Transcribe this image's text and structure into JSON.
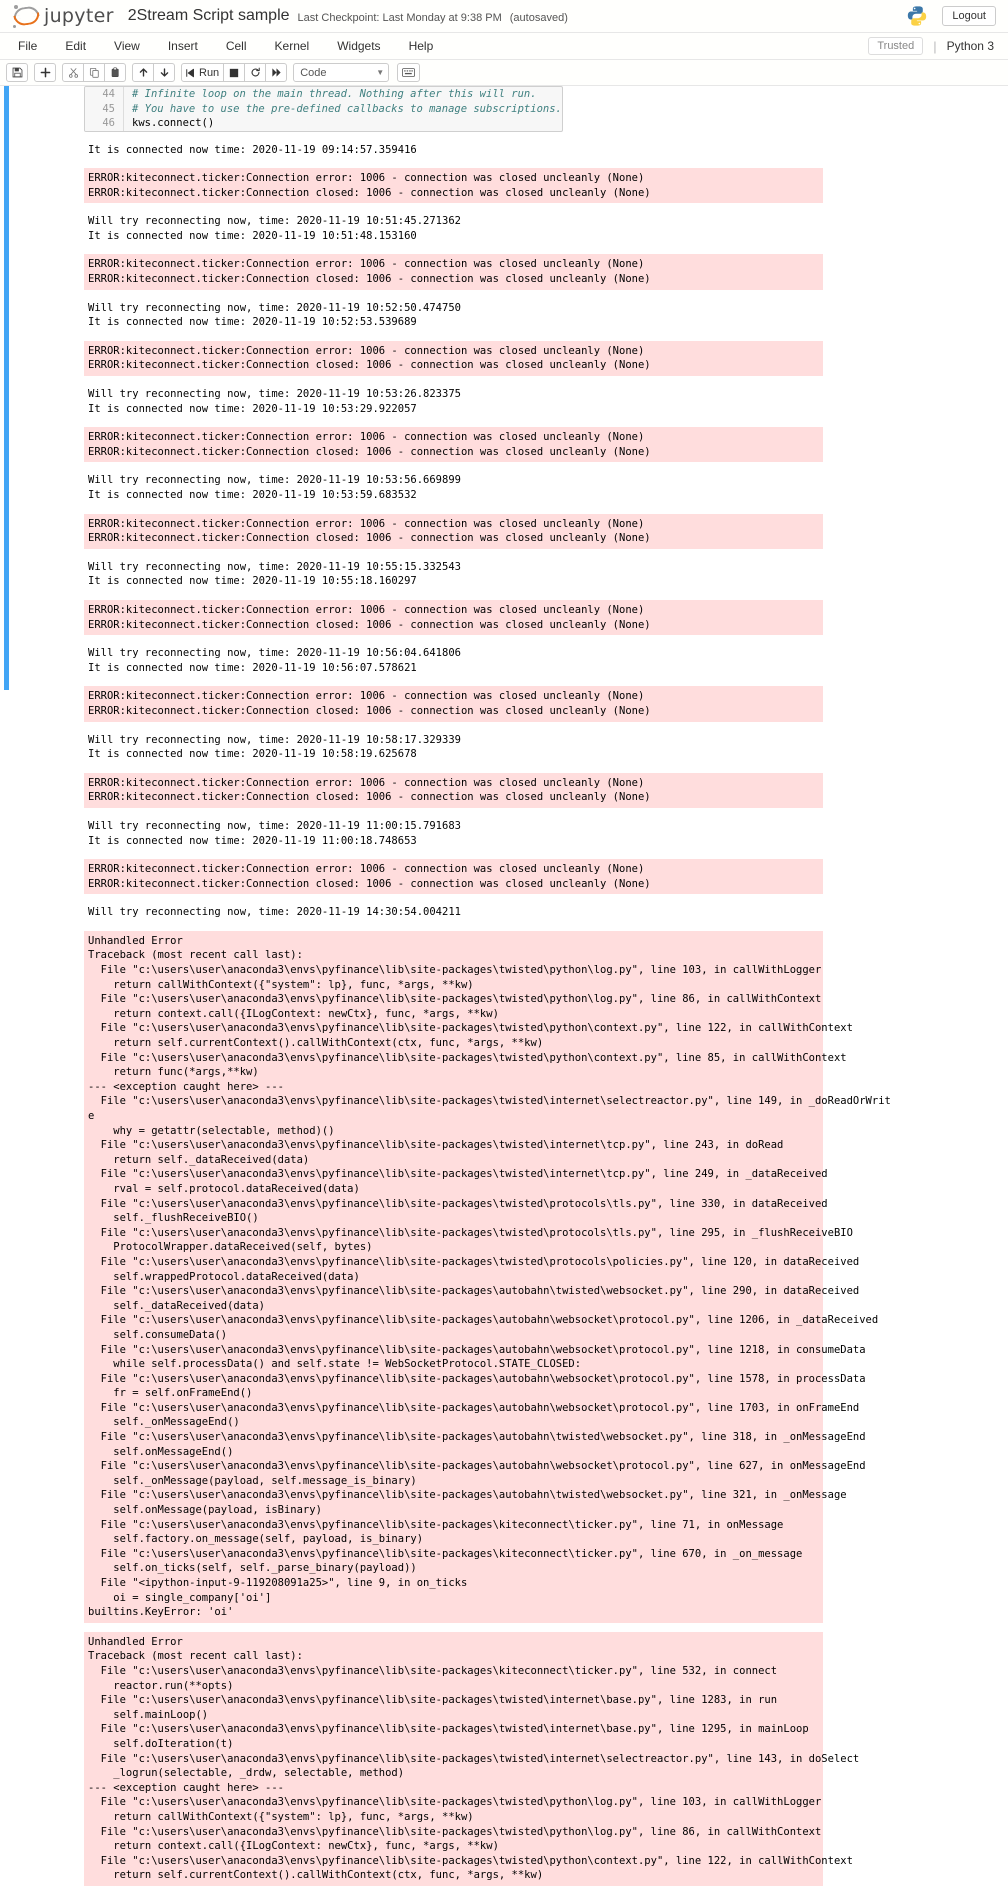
{
  "header": {
    "logo_text": "jupyter",
    "notebook_name": "2Stream Script sample",
    "checkpoint": "Last Checkpoint: Last Monday at 9:38 PM",
    "autosaved": "(autosaved)",
    "logout_label": "Logout",
    "python_logo_icon": "python-logo-icon"
  },
  "menubar": {
    "items": [
      "File",
      "Edit",
      "View",
      "Insert",
      "Cell",
      "Kernel",
      "Widgets",
      "Help"
    ],
    "trusted_label": "Trusted",
    "kernel_name": "Python 3"
  },
  "toolbar": {
    "save_icon": "save-icon",
    "insert_icon": "plus-icon",
    "cut_icon": "scissors-icon",
    "copy_icon": "copy-icon",
    "paste_icon": "paste-icon",
    "move_up_icon": "arrow-up-icon",
    "move_down_icon": "arrow-down-icon",
    "run_label": "Run",
    "run_icon": "run-icon",
    "stop_icon": "stop-square-icon",
    "restart_icon": "restart-circular-arrow-icon",
    "restart_run_all_icon": "fast-forward-icon",
    "cell_type_value": "Code",
    "cell_type_chevron": "chevron-down-icon",
    "command_palette_icon": "keyboard-icon"
  },
  "cell": {
    "lines": [
      {
        "n": "44",
        "text": "# Infinite loop on the main thread. Nothing after this will run.",
        "style": "cmt"
      },
      {
        "n": "45",
        "text": "# You have to use the pre-defined callbacks to manage subscriptions.",
        "style": "cmt"
      },
      {
        "n": "46",
        "text": "kws.connect()",
        "style": "plain"
      }
    ]
  },
  "outputs": [
    {
      "type": "stdout",
      "lines": [
        "It is connected now time: 2020-11-19 09:14:57.359416"
      ]
    },
    {
      "type": "stderr",
      "lines": [
        "ERROR:kiteconnect.ticker:Connection error: 1006 - connection was closed uncleanly (None)",
        "ERROR:kiteconnect.ticker:Connection closed: 1006 - connection was closed uncleanly (None)"
      ]
    },
    {
      "type": "stdout",
      "lines": [
        "Will try reconnecting now, time: 2020-11-19 10:51:45.271362",
        "It is connected now time: 2020-11-19 10:51:48.153160"
      ]
    },
    {
      "type": "stderr",
      "lines": [
        "ERROR:kiteconnect.ticker:Connection error: 1006 - connection was closed uncleanly (None)",
        "ERROR:kiteconnect.ticker:Connection closed: 1006 - connection was closed uncleanly (None)"
      ]
    },
    {
      "type": "stdout",
      "lines": [
        "Will try reconnecting now, time: 2020-11-19 10:52:50.474750",
        "It is connected now time: 2020-11-19 10:52:53.539689"
      ]
    },
    {
      "type": "stderr",
      "lines": [
        "ERROR:kiteconnect.ticker:Connection error: 1006 - connection was closed uncleanly (None)",
        "ERROR:kiteconnect.ticker:Connection closed: 1006 - connection was closed uncleanly (None)"
      ]
    },
    {
      "type": "stdout",
      "lines": [
        "Will try reconnecting now, time: 2020-11-19 10:53:26.823375",
        "It is connected now time: 2020-11-19 10:53:29.922057"
      ]
    },
    {
      "type": "stderr",
      "lines": [
        "ERROR:kiteconnect.ticker:Connection error: 1006 - connection was closed uncleanly (None)",
        "ERROR:kiteconnect.ticker:Connection closed: 1006 - connection was closed uncleanly (None)"
      ]
    },
    {
      "type": "stdout",
      "lines": [
        "Will try reconnecting now, time: 2020-11-19 10:53:56.669899",
        "It is connected now time: 2020-11-19 10:53:59.683532"
      ]
    },
    {
      "type": "stderr",
      "lines": [
        "ERROR:kiteconnect.ticker:Connection error: 1006 - connection was closed uncleanly (None)",
        "ERROR:kiteconnect.ticker:Connection closed: 1006 - connection was closed uncleanly (None)"
      ]
    },
    {
      "type": "stdout",
      "lines": [
        "Will try reconnecting now, time: 2020-11-19 10:55:15.332543",
        "It is connected now time: 2020-11-19 10:55:18.160297"
      ]
    },
    {
      "type": "stderr",
      "lines": [
        "ERROR:kiteconnect.ticker:Connection error: 1006 - connection was closed uncleanly (None)",
        "ERROR:kiteconnect.ticker:Connection closed: 1006 - connection was closed uncleanly (None)"
      ]
    },
    {
      "type": "stdout",
      "lines": [
        "Will try reconnecting now, time: 2020-11-19 10:56:04.641806",
        "It is connected now time: 2020-11-19 10:56:07.578621"
      ]
    },
    {
      "type": "stderr",
      "lines": [
        "ERROR:kiteconnect.ticker:Connection error: 1006 - connection was closed uncleanly (None)",
        "ERROR:kiteconnect.ticker:Connection closed: 1006 - connection was closed uncleanly (None)"
      ]
    },
    {
      "type": "stdout",
      "lines": [
        "Will try reconnecting now, time: 2020-11-19 10:58:17.329339",
        "It is connected now time: 2020-11-19 10:58:19.625678"
      ]
    },
    {
      "type": "stderr",
      "lines": [
        "ERROR:kiteconnect.ticker:Connection error: 1006 - connection was closed uncleanly (None)",
        "ERROR:kiteconnect.ticker:Connection closed: 1006 - connection was closed uncleanly (None)"
      ]
    },
    {
      "type": "stdout",
      "lines": [
        "Will try reconnecting now, time: 2020-11-19 11:00:15.791683",
        "It is connected now time: 2020-11-19 11:00:18.748653"
      ]
    },
    {
      "type": "stderr",
      "lines": [
        "ERROR:kiteconnect.ticker:Connection error: 1006 - connection was closed uncleanly (None)",
        "ERROR:kiteconnect.ticker:Connection closed: 1006 - connection was closed uncleanly (None)"
      ]
    },
    {
      "type": "stdout",
      "lines": [
        "Will try reconnecting now, time: 2020-11-19 14:30:54.004211"
      ]
    },
    {
      "type": "stderr",
      "lines": [
        "Unhandled Error",
        "Traceback (most recent call last):",
        "  File \"c:\\users\\user\\anaconda3\\envs\\pyfinance\\lib\\site-packages\\twisted\\python\\log.py\", line 103, in callWithLogger",
        "    return callWithContext({\"system\": lp}, func, *args, **kw)",
        "  File \"c:\\users\\user\\anaconda3\\envs\\pyfinance\\lib\\site-packages\\twisted\\python\\log.py\", line 86, in callWithContext",
        "    return context.call({ILogContext: newCtx}, func, *args, **kw)",
        "  File \"c:\\users\\user\\anaconda3\\envs\\pyfinance\\lib\\site-packages\\twisted\\python\\context.py\", line 122, in callWithContext",
        "    return self.currentContext().callWithContext(ctx, func, *args, **kw)",
        "  File \"c:\\users\\user\\anaconda3\\envs\\pyfinance\\lib\\site-packages\\twisted\\python\\context.py\", line 85, in callWithContext",
        "    return func(*args,**kw)",
        "--- <exception caught here> ---",
        "  File \"c:\\users\\user\\anaconda3\\envs\\pyfinance\\lib\\site-packages\\twisted\\internet\\selectreactor.py\", line 149, in _doReadOrWrit",
        "e",
        "    why = getattr(selectable, method)()",
        "  File \"c:\\users\\user\\anaconda3\\envs\\pyfinance\\lib\\site-packages\\twisted\\internet\\tcp.py\", line 243, in doRead",
        "    return self._dataReceived(data)",
        "  File \"c:\\users\\user\\anaconda3\\envs\\pyfinance\\lib\\site-packages\\twisted\\internet\\tcp.py\", line 249, in _dataReceived",
        "    rval = self.protocol.dataReceived(data)",
        "  File \"c:\\users\\user\\anaconda3\\envs\\pyfinance\\lib\\site-packages\\twisted\\protocols\\tls.py\", line 330, in dataReceived",
        "    self._flushReceiveBIO()",
        "  File \"c:\\users\\user\\anaconda3\\envs\\pyfinance\\lib\\site-packages\\twisted\\protocols\\tls.py\", line 295, in _flushReceiveBIO",
        "    ProtocolWrapper.dataReceived(self, bytes)",
        "  File \"c:\\users\\user\\anaconda3\\envs\\pyfinance\\lib\\site-packages\\twisted\\protocols\\policies.py\", line 120, in dataReceived",
        "    self.wrappedProtocol.dataReceived(data)",
        "  File \"c:\\users\\user\\anaconda3\\envs\\pyfinance\\lib\\site-packages\\autobahn\\twisted\\websocket.py\", line 290, in dataReceived",
        "    self._dataReceived(data)",
        "  File \"c:\\users\\user\\anaconda3\\envs\\pyfinance\\lib\\site-packages\\autobahn\\websocket\\protocol.py\", line 1206, in _dataReceived",
        "    self.consumeData()",
        "  File \"c:\\users\\user\\anaconda3\\envs\\pyfinance\\lib\\site-packages\\autobahn\\websocket\\protocol.py\", line 1218, in consumeData",
        "    while self.processData() and self.state != WebSocketProtocol.STATE_CLOSED:",
        "  File \"c:\\users\\user\\anaconda3\\envs\\pyfinance\\lib\\site-packages\\autobahn\\websocket\\protocol.py\", line 1578, in processData",
        "    fr = self.onFrameEnd()",
        "  File \"c:\\users\\user\\anaconda3\\envs\\pyfinance\\lib\\site-packages\\autobahn\\websocket\\protocol.py\", line 1703, in onFrameEnd",
        "    self._onMessageEnd()",
        "  File \"c:\\users\\user\\anaconda3\\envs\\pyfinance\\lib\\site-packages\\autobahn\\twisted\\websocket.py\", line 318, in _onMessageEnd",
        "    self.onMessageEnd()",
        "  File \"c:\\users\\user\\anaconda3\\envs\\pyfinance\\lib\\site-packages\\autobahn\\websocket\\protocol.py\", line 627, in onMessageEnd",
        "    self._onMessage(payload, self.message_is_binary)",
        "  File \"c:\\users\\user\\anaconda3\\envs\\pyfinance\\lib\\site-packages\\autobahn\\twisted\\websocket.py\", line 321, in _onMessage",
        "    self.onMessage(payload, isBinary)",
        "  File \"c:\\users\\user\\anaconda3\\envs\\pyfinance\\lib\\site-packages\\kiteconnect\\ticker.py\", line 71, in onMessage",
        "    self.factory.on_message(self, payload, is_binary)",
        "  File \"c:\\users\\user\\anaconda3\\envs\\pyfinance\\lib\\site-packages\\kiteconnect\\ticker.py\", line 670, in _on_message",
        "    self.on_ticks(self, self._parse_binary(payload))",
        "  File \"<ipython-input-9-119208091a25>\", line 9, in on_ticks",
        "    oi = single_company['oi']",
        "builtins.KeyError: 'oi'"
      ]
    },
    {
      "type": "stderr",
      "lines": [
        "Unhandled Error",
        "Traceback (most recent call last):",
        "  File \"c:\\users\\user\\anaconda3\\envs\\pyfinance\\lib\\site-packages\\kiteconnect\\ticker.py\", line 532, in connect",
        "    reactor.run(**opts)",
        "  File \"c:\\users\\user\\anaconda3\\envs\\pyfinance\\lib\\site-packages\\twisted\\internet\\base.py\", line 1283, in run",
        "    self.mainLoop()",
        "  File \"c:\\users\\user\\anaconda3\\envs\\pyfinance\\lib\\site-packages\\twisted\\internet\\base.py\", line 1295, in mainLoop",
        "    self.doIteration(t)",
        "  File \"c:\\users\\user\\anaconda3\\envs\\pyfinance\\lib\\site-packages\\twisted\\internet\\selectreactor.py\", line 143, in doSelect",
        "    _logrun(selectable, _drdw, selectable, method)",
        "--- <exception caught here> ---",
        "  File \"c:\\users\\user\\anaconda3\\envs\\pyfinance\\lib\\site-packages\\twisted\\python\\log.py\", line 103, in callWithLogger",
        "    return callWithContext({\"system\": lp}, func, *args, **kw)",
        "  File \"c:\\users\\user\\anaconda3\\envs\\pyfinance\\lib\\site-packages\\twisted\\python\\log.py\", line 86, in callWithContext",
        "    return context.call({ILogContext: newCtx}, func, *args, **kw)",
        "  File \"c:\\users\\user\\anaconda3\\envs\\pyfinance\\lib\\site-packages\\twisted\\python\\context.py\", line 122, in callWithContext",
        "    return self.currentContext().callWithContext(ctx, func, *args, **kw)"
      ]
    }
  ]
}
